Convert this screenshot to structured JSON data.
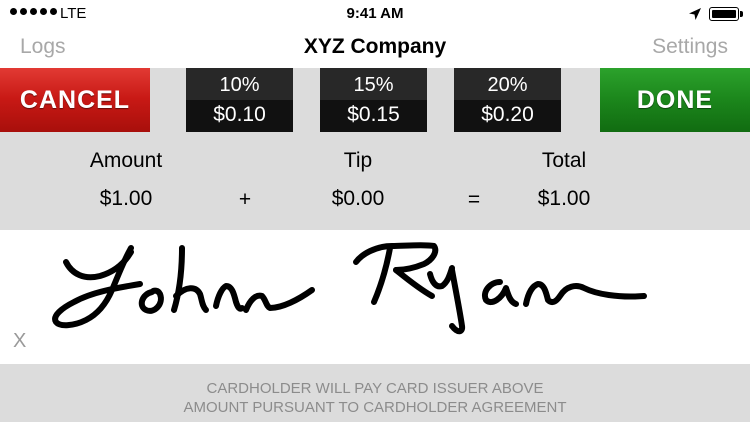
{
  "status_bar": {
    "signal_icon": "signal-dots-icon",
    "carrier": "LTE",
    "time": "9:41 AM",
    "location_icon": "location-arrow-icon",
    "battery_icon": "battery-icon"
  },
  "nav": {
    "left_label": "Logs",
    "title": "XYZ Company",
    "right_label": "Settings"
  },
  "actions": {
    "cancel_label": "CANCEL",
    "done_label": "DONE",
    "cancel_color": "#c81915",
    "done_color": "#1c871c"
  },
  "tip_options": [
    {
      "percent": "10%",
      "amount": "$0.10"
    },
    {
      "percent": "15%",
      "amount": "$0.15"
    },
    {
      "percent": "20%",
      "amount": "$0.20"
    }
  ],
  "summary": {
    "amount_label": "Amount",
    "amount_value": "$1.00",
    "plus": "+",
    "tip_label": "Tip",
    "tip_value": "$0.00",
    "equals": "=",
    "total_label": "Total",
    "total_value": "$1.00"
  },
  "signature": {
    "x_mark": "X",
    "signed_name_image": "handwritten-signature"
  },
  "footer": {
    "disclaimer_line1": "CARDHOLDER WILL PAY CARD ISSUER ABOVE",
    "disclaimer_line2": "AMOUNT PURSUANT TO CARDHOLDER AGREEMENT"
  }
}
